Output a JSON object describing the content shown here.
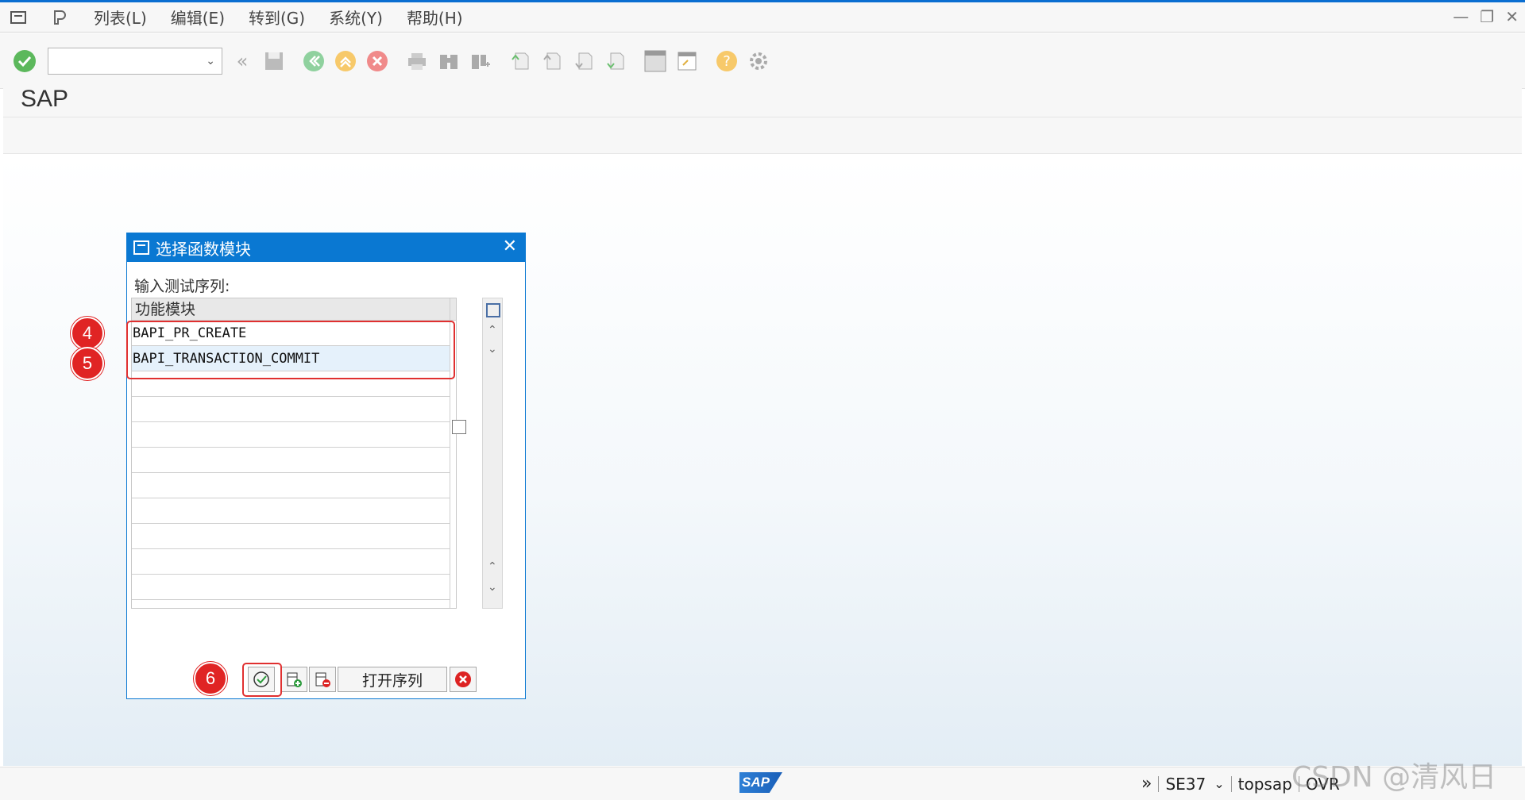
{
  "menubar": {
    "items": [
      "列表(L)",
      "编辑(E)",
      "转到(G)",
      "系统(Y)",
      "帮助(H)"
    ]
  },
  "toolbar": {
    "command_value": ""
  },
  "title": "SAP",
  "dialog": {
    "title": "选择函数模块",
    "label": "输入测试序列:",
    "column_header": "功能模块",
    "rows": [
      "BAPI_PR_CREATE",
      "BAPI_TRANSACTION_COMMIT",
      "",
      "",
      "",
      "",
      "",
      "",
      "",
      "",
      ""
    ],
    "open_sequence_label": "打开序列"
  },
  "annotations": {
    "step4": "4",
    "step5": "5",
    "step6": "6"
  },
  "statusbar": {
    "tcode": "SE37",
    "user": "topsap",
    "mode": "OVR"
  },
  "watermark": "CSDN @清风日下",
  "colors": {
    "accent": "#0a78d2",
    "annotation": "#e02424"
  }
}
